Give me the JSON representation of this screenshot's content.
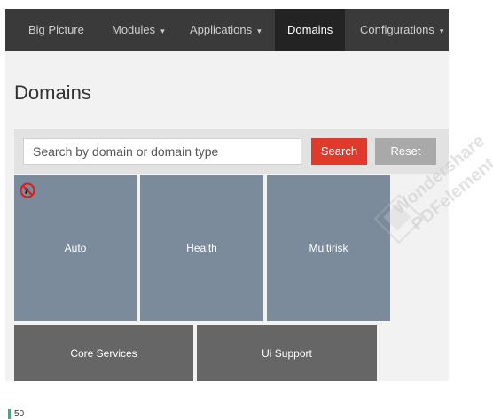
{
  "nav": {
    "items": [
      {
        "label": "Big Picture",
        "dropdown": false,
        "active": false
      },
      {
        "label": "Modules",
        "dropdown": true,
        "active": false
      },
      {
        "label": "Applications",
        "dropdown": true,
        "active": false
      },
      {
        "label": "Domains",
        "dropdown": false,
        "active": true
      },
      {
        "label": "Configurations",
        "dropdown": true,
        "active": false
      }
    ],
    "caret_icon": "chevron-down-icon"
  },
  "page": {
    "title": "Domains"
  },
  "search": {
    "placeholder": "Search by domain or domain type",
    "value": "",
    "search_label": "Search",
    "reset_label": "Reset"
  },
  "tiles": [
    {
      "label": "Auto",
      "color": "#7b8b9b",
      "badge_icon": "no-entry-icon"
    },
    {
      "label": "Health",
      "color": "#7b8b9b"
    },
    {
      "label": "Multirisk",
      "color": "#7b8b9b"
    },
    {
      "label": "Core Services",
      "color": "#666666"
    },
    {
      "label": "Ui Support",
      "color": "#666666"
    }
  ],
  "footer": {
    "page_number": "50"
  },
  "watermark": {
    "lines": [
      "Wondershare",
      "PDFelement"
    ]
  },
  "colors": {
    "navbar": "#3a3a3a",
    "nav_active": "#232323",
    "search_button": "#e03a2c",
    "reset_button": "#a9a9a9",
    "page_marker": "#2bb673"
  }
}
